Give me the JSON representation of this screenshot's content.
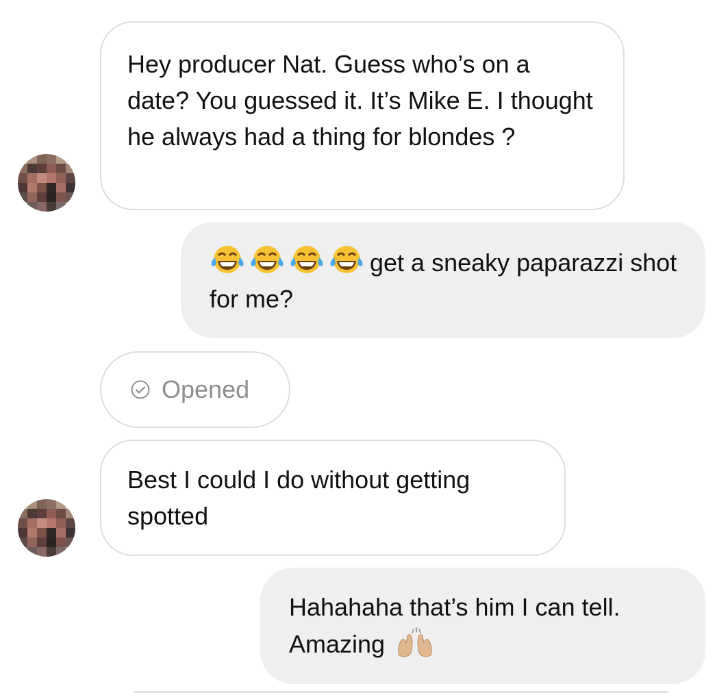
{
  "thread": {
    "messages": [
      {
        "sender": "them",
        "text": "Hey producer Nat. Guess who’s on a date? You guessed it. It’s Mike E. I thought he always had a thing for blondes ?"
      },
      {
        "sender": "me",
        "emojis": [
          "tears-of-joy",
          "tears-of-joy",
          "tears-of-joy",
          "tears-of-joy"
        ],
        "text": "get a sneaky paparazzi shot for me?"
      },
      {
        "sender": "status",
        "text": "Opened"
      },
      {
        "sender": "them",
        "text": "Best I could I do without getting spotted"
      },
      {
        "sender": "me",
        "text": "Hahahaha that’s him I can tell. Amazing",
        "trailing_emoji": "raising-hands"
      }
    ]
  },
  "colors": {
    "incoming_bubble_bg": "#ffffff",
    "incoming_bubble_border": "#dedede",
    "outgoing_bubble_bg": "#efefef",
    "text": "#111111",
    "status_text": "#8e8e8e"
  }
}
